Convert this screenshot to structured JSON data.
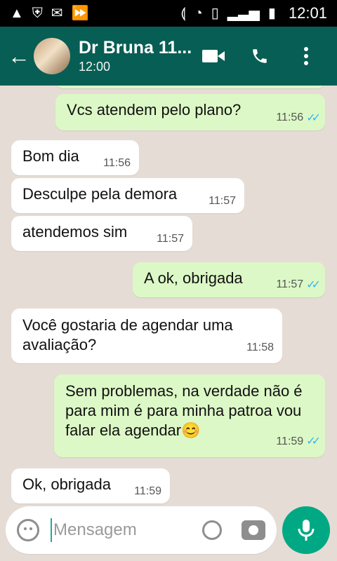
{
  "status_bar": {
    "time": "12:01",
    "icons_left": [
      "warning-icon",
      "shield-icon",
      "mail-icon",
      "fast-forward-icon"
    ],
    "icons_right": [
      "vibrate-icon",
      "wifi-icon",
      "sim-1-icon",
      "signal-icon",
      "battery-icon"
    ]
  },
  "header": {
    "contact_name": "Dr Bruna 11...",
    "last_seen": "12:00"
  },
  "messages": [
    {
      "side": "out",
      "text": "Vcs atendem pelo plano?",
      "time": "11:56",
      "ticks": true
    },
    {
      "side": "in",
      "text": "Bom dia",
      "time": "11:56"
    },
    {
      "side": "in",
      "text": "Desculpe pela demora",
      "time": "11:57"
    },
    {
      "side": "in",
      "text": "atendemos sim",
      "time": "11:57"
    },
    {
      "side": "out",
      "text": "A ok,  obrigada",
      "time": "11:57",
      "ticks": true
    },
    {
      "side": "in",
      "text": "Você gostaria de agendar uma avaliação?",
      "time": "11:58"
    },
    {
      "side": "out",
      "text": "Sem problemas, na verdade não é para mim é para minha  patroa vou falar ela agendar😊",
      "time": "11:59",
      "ticks": true
    },
    {
      "side": "in",
      "text": "Ok, obrigada",
      "time": "11:59"
    }
  ],
  "composer": {
    "placeholder": "Mensagem"
  }
}
